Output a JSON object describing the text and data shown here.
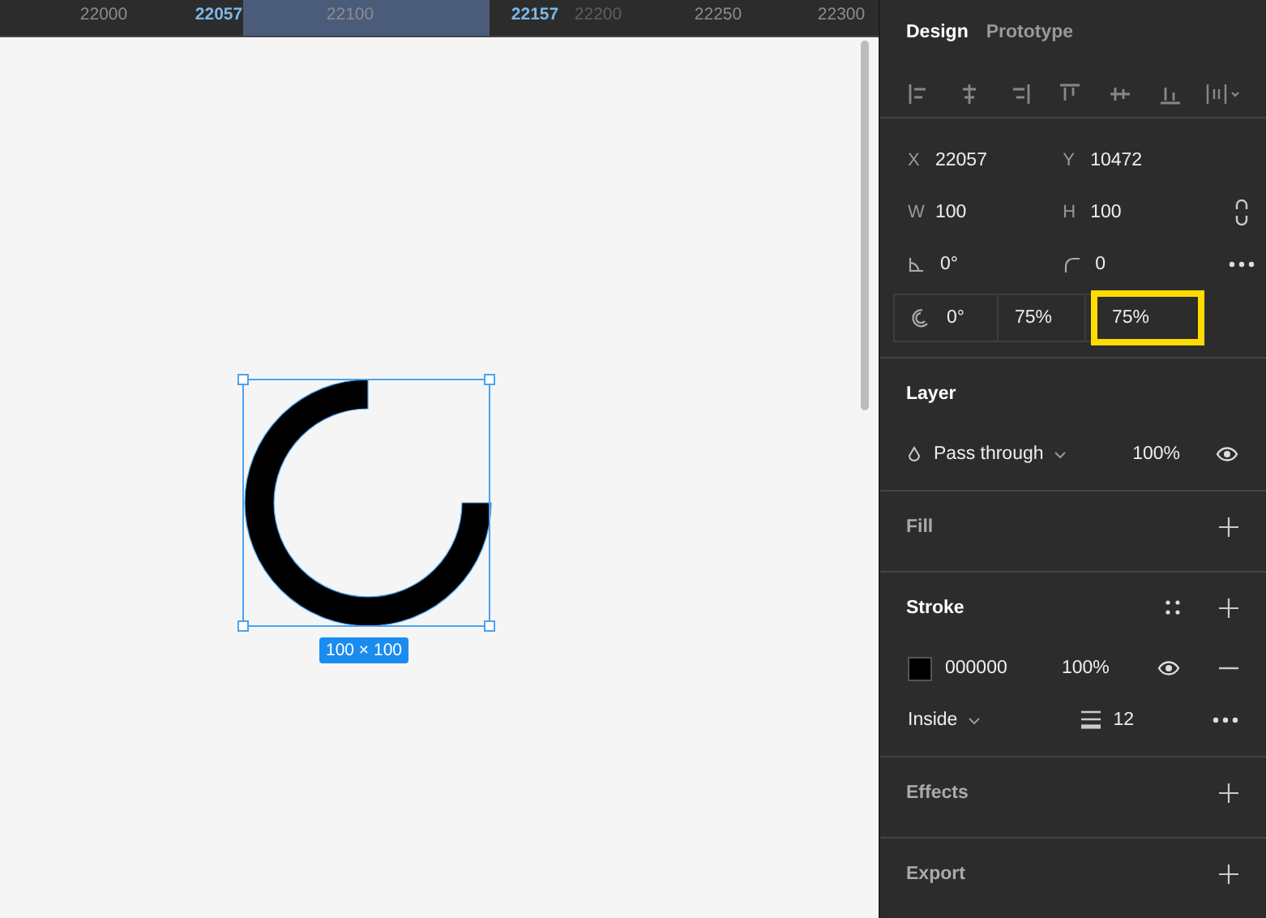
{
  "ruler": {
    "labels": [
      {
        "text": "22000",
        "kind": "tick"
      },
      {
        "text": "22057",
        "kind": "bound"
      },
      {
        "text": "22100",
        "kind": "tick"
      },
      {
        "text": "22157",
        "kind": "bound"
      },
      {
        "text": "22200",
        "kind": "faded"
      },
      {
        "text": "22250",
        "kind": "tick"
      },
      {
        "text": "22300",
        "kind": "tick"
      }
    ]
  },
  "canvas": {
    "selection_size": "100 × 100"
  },
  "panel": {
    "tabs": [
      {
        "label": "Design",
        "selected": true
      },
      {
        "label": "Prototype",
        "selected": false
      }
    ],
    "geometry": {
      "x": {
        "label": "X",
        "value": "22057"
      },
      "y": {
        "label": "Y",
        "value": "10472"
      },
      "w": {
        "label": "W",
        "value": "100"
      },
      "h": {
        "label": "H",
        "value": "100"
      },
      "rotation": "0°",
      "corner_radius": "0",
      "arc": [
        {
          "kind": "start",
          "value": "0°",
          "highlighted": false
        },
        {
          "kind": "sweep",
          "value": "75%",
          "highlighted": false
        },
        {
          "kind": "ratio",
          "value": "75%",
          "highlighted": true
        }
      ]
    },
    "layer": {
      "title": "Layer",
      "blend_mode": "Pass through",
      "opacity": "100%",
      "visible": true
    },
    "fill": {
      "title": "Fill"
    },
    "stroke": {
      "title": "Stroke",
      "color": "#000000",
      "hex": "000000",
      "opacity": "100%",
      "visible": true,
      "position": "Inside",
      "weight": "12"
    },
    "effects": {
      "title": "Effects"
    },
    "export": {
      "title": "Export"
    }
  }
}
